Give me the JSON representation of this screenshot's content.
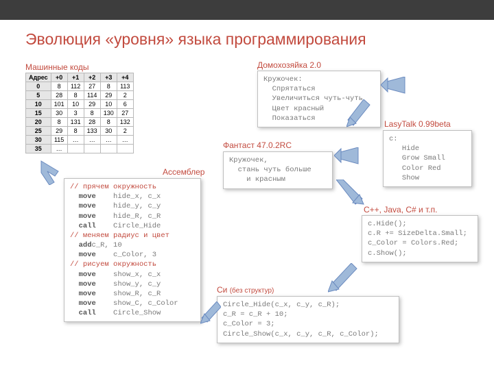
{
  "title": "Эволюция «уровня» языка программирования",
  "labels": {
    "machine": "Машинные коды",
    "assembler": "Ассемблер",
    "housewife": "Домохозяйка 2.0",
    "fantast": "Фантаст 47.0.2RC",
    "lasytalk": "LasyTalk 0.99beta",
    "cpp": "C++, Java, C# и т.п.",
    "c": "Си",
    "c_sub": "(без структур)"
  },
  "machine_table": {
    "headers": [
      "Адрес",
      "+0",
      "+1",
      "+2",
      "+3",
      "+4"
    ],
    "rows": [
      [
        "0",
        "8",
        "112",
        "27",
        "8",
        "113"
      ],
      [
        "5",
        "28",
        "8",
        "114",
        "29",
        "2"
      ],
      [
        "10",
        "101",
        "10",
        "29",
        "10",
        "6"
      ],
      [
        "15",
        "30",
        "3",
        "8",
        "130",
        "27"
      ],
      [
        "20",
        "8",
        "131",
        "28",
        "8",
        "132"
      ],
      [
        "25",
        "29",
        "8",
        "133",
        "30",
        "2"
      ],
      [
        "30",
        "115",
        "…",
        "…",
        "…",
        "…"
      ],
      [
        "35",
        "…",
        "",
        "",
        "",
        ""
      ]
    ]
  },
  "asm": {
    "c1": "// прячем окружность",
    "l1a": "move",
    "l1b": "hide_x, c_x",
    "l2a": "move",
    "l2b": "hide_y, c_y",
    "l3a": "move",
    "l3b": "hide_R, c_R",
    "l4a": "call",
    "l4b": "Circle_Hide",
    "c2": "// меняем радиус и цвет",
    "l5a": "add",
    "l5b": "c_R, 10",
    "l6a": "move",
    "l6b": "c_Color, 3",
    "c3": "// рисуем окружность",
    "l7a": "move",
    "l7b": "show_x, c_x",
    "l8a": "move",
    "l8b": "show_y, c_y",
    "l9a": "move",
    "l9b": "show_R, c_R",
    "l10a": "move",
    "l10b": "show_C, c_Color",
    "l11a": "call",
    "l11b": "Circle_Show"
  },
  "housewife_code": "Кружочек:\n  Спрятаться\n  Увеличиться чуть-чуть\n  Цвет красный\n  Показаться",
  "fantast_code": "Кружочек,\n  стань чуть больше\n    и красным",
  "lasytalk_code": "c:\n   Hide\n   Grow Small\n   Color Red\n   Show",
  "cpp_code": "c.Hide();\nc.R += SizeDelta.Small;\nc_Color = Colors.Red;\nc.Show();",
  "c_code": "Circle_Hide(c_x, c_y, c_R);\nc_R = c_R + 10;\nc_Color = 3;\nCircle_Show(c_x, c_y, c_R, c_Color);"
}
